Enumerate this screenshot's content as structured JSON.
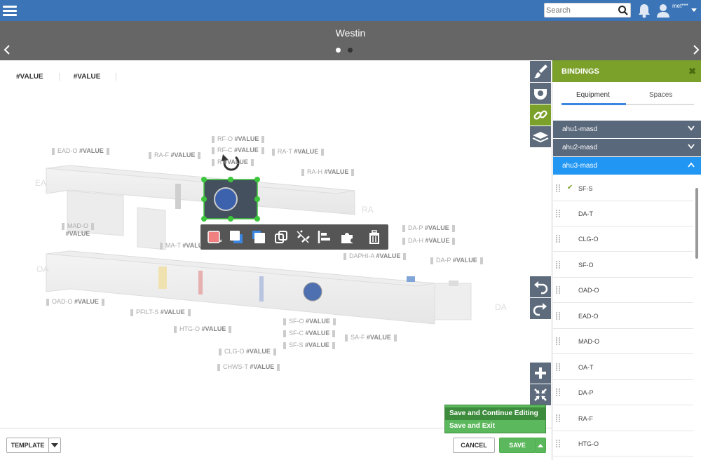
{
  "app": {
    "site_title": "Westin",
    "search_placeholder": "Search",
    "user_name": "met***"
  },
  "header_values": [
    "#VALUE",
    "#VALUE"
  ],
  "diagram_labels": [
    {
      "id": "rf-o",
      "name": "RF-O",
      "value": "#VALUE"
    },
    {
      "id": "rf-c",
      "name": "RF-C",
      "value": "#VALUE"
    },
    {
      "id": "rf-s",
      "name": "R",
      "value": "#VALUE"
    },
    {
      "id": "ead-o",
      "name": "EAD-O",
      "value": "#VALUE"
    },
    {
      "id": "ra-f",
      "name": "RA-F",
      "value": "#VALUE"
    },
    {
      "id": "ra-t",
      "name": "RA-T",
      "value": "#VALUE"
    },
    {
      "id": "ra-h",
      "name": "RA-H",
      "value": "#VALUE"
    },
    {
      "id": "mad-o",
      "name": "MAD-O",
      "value": "#VALUE"
    },
    {
      "id": "ma-t",
      "name": "MA-T",
      "value": "#VALUE"
    },
    {
      "id": "da-p1",
      "name": "DA-P",
      "value": "#VALUE"
    },
    {
      "id": "da-h",
      "name": "DA-H",
      "value": "#VALUE"
    },
    {
      "id": "daphi-a",
      "name": "DAPHI-A",
      "value": "#VALUE"
    },
    {
      "id": "da-p2",
      "name": "DA-P",
      "value": "#VALUE"
    },
    {
      "id": "oad-o",
      "name": "OAD-O",
      "value": "#VALUE"
    },
    {
      "id": "pfilt-s",
      "name": "PFILT-S",
      "value": "#VALUE"
    },
    {
      "id": "htg-o",
      "name": "HTG-O",
      "value": "#VALUE"
    },
    {
      "id": "sf-o",
      "name": "SF-O",
      "value": "#VALUE"
    },
    {
      "id": "sf-c",
      "name": "SF-C",
      "value": "#VALUE"
    },
    {
      "id": "sf-s",
      "name": "SF-S",
      "value": "#VALUE"
    },
    {
      "id": "sa-f",
      "name": "SA-F",
      "value": "#VALUE"
    },
    {
      "id": "clg-o",
      "name": "CLG-O",
      "value": "#VALUE"
    },
    {
      "id": "chws-t",
      "name": "CHWS-T",
      "value": "#VALUE"
    }
  ],
  "diagram_zone_labels": {
    "ea": "EA",
    "ra": "RA",
    "oa": "OA",
    "da": "DA"
  },
  "footer": {
    "template_label": "TEMPLATE",
    "cancel_label": "CANCEL",
    "save_label": "SAVE",
    "save_menu": [
      "Save and Continue Editing",
      "Save and Exit"
    ]
  },
  "bindings": {
    "title": "BINDINGS",
    "close": "✖",
    "tabs": [
      {
        "label": "Equipment",
        "active": true
      },
      {
        "label": "Spaces",
        "active": false
      }
    ],
    "groups": [
      {
        "label": "ahu1-masd",
        "expanded": false
      },
      {
        "label": "ahu2-masd",
        "expanded": false
      },
      {
        "label": "ahu3-masd",
        "expanded": true
      }
    ],
    "points": [
      {
        "label": "SF-S",
        "checked": true
      },
      {
        "label": "DA-T",
        "checked": false
      },
      {
        "label": "CLG-O",
        "checked": false
      },
      {
        "label": "SF-O",
        "checked": false
      },
      {
        "label": "OAD-O",
        "checked": false
      },
      {
        "label": "EAD-O",
        "checked": false
      },
      {
        "label": "MAD-O",
        "checked": false
      },
      {
        "label": "OA-T",
        "checked": false
      },
      {
        "label": "DA-P",
        "checked": false
      },
      {
        "label": "RA-F",
        "checked": false
      },
      {
        "label": "HTG-O",
        "checked": false
      }
    ]
  },
  "colors": {
    "topbar": "#3b74b7",
    "titlebar": "#666666",
    "panel_head": "#7ca12a",
    "group": "#5a687b",
    "group_active": "#2196f3",
    "save": "#5cb85c"
  },
  "icons": {
    "side_tools": [
      "paintbrush-icon",
      "ring-icon",
      "link-icon",
      "layers-icon",
      "undo-icon",
      "redo-icon",
      "plus-icon",
      "collapse-icon"
    ],
    "toolbar": [
      "fill-color-icon",
      "bring-forward-icon",
      "send-back-icon",
      "copy-icon",
      "unlink-icon",
      "align-icon",
      "puzzle-icon",
      "trash-icon"
    ]
  }
}
